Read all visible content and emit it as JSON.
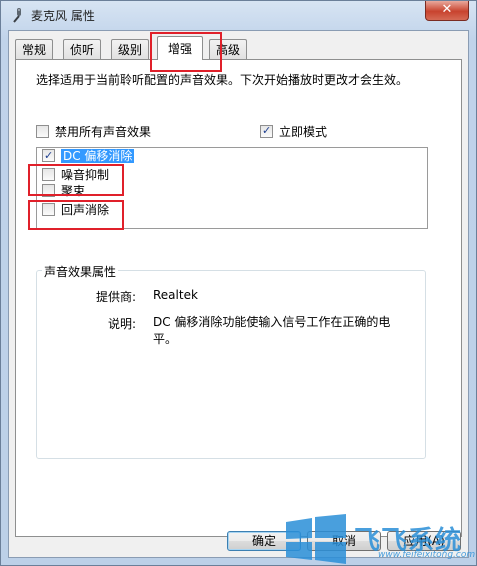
{
  "window": {
    "title": "麦克风 属性",
    "close_glyph": "✕"
  },
  "tabs": [
    {
      "label": "常规"
    },
    {
      "label": "侦听"
    },
    {
      "label": "级别"
    },
    {
      "label": "增强"
    },
    {
      "label": "高级"
    }
  ],
  "active_tab": "增强",
  "panel": {
    "description": "选择适用于当前聆听配置的声音效果。下次开始播放时更改才会生效。",
    "disable_all": {
      "label": "禁用所有声音效果",
      "checked": false
    },
    "immediate_mode": {
      "label": "立即模式",
      "checked": true
    },
    "effects": [
      {
        "label": "DC 偏移消除",
        "checked": true,
        "selected": true
      },
      {
        "label": "噪音抑制",
        "checked": false
      },
      {
        "label": "聚束",
        "checked": false
      },
      {
        "label": "回声消除",
        "checked": false
      }
    ],
    "properties_group": {
      "title": "声音效果属性",
      "provider_label": "提供商:",
      "provider_value": "Realtek",
      "description_label": "说明:",
      "description_value": "DC 偏移消除功能使输入信号工作在正确的电平。"
    }
  },
  "buttons": {
    "ok": "确定",
    "cancel": "取消",
    "apply": "应用(A)"
  },
  "watermark": {
    "brand": "飞飞系统",
    "url": "www.feifeixitong.com"
  },
  "colors": {
    "annotation_red": "#e0202a",
    "selection": "#3399ff",
    "watermark_blue": "#2a8fd8"
  }
}
